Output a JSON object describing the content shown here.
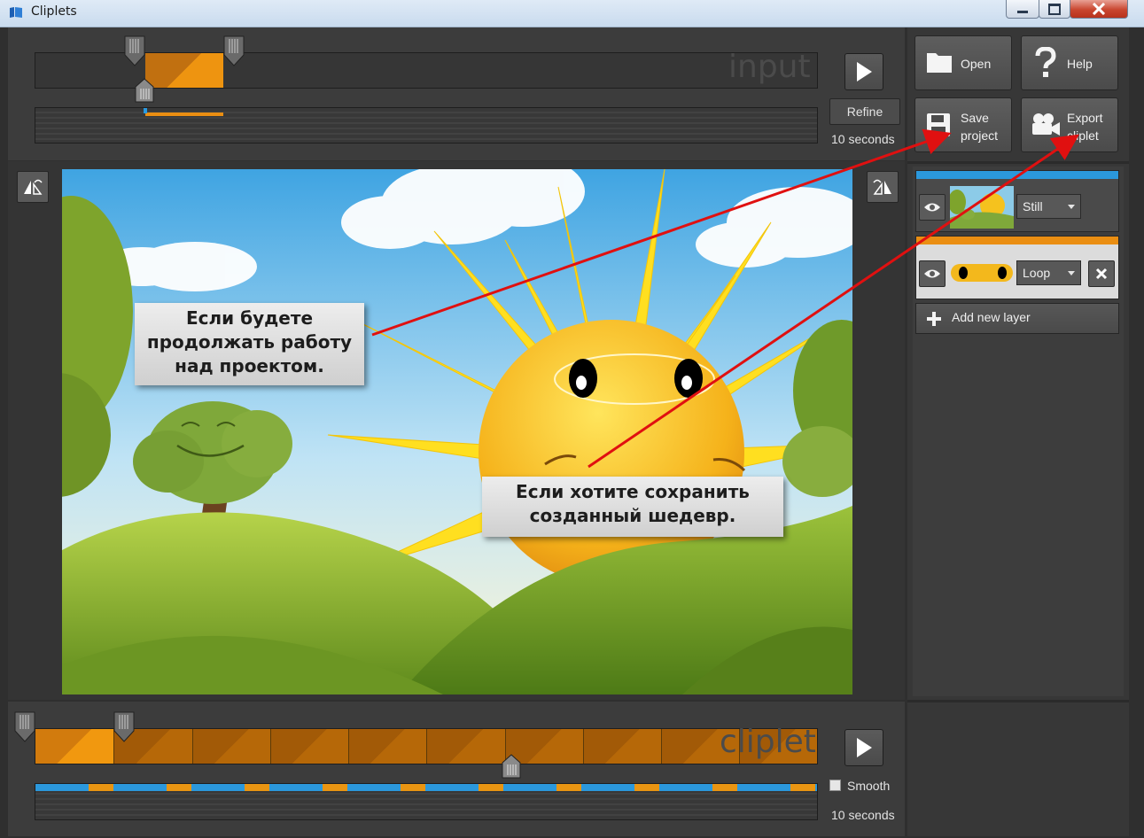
{
  "window": {
    "title": "Cliplets"
  },
  "input_panel": {
    "watermark": "input",
    "refine_label": "Refine",
    "duration": "10 seconds"
  },
  "clip_panel": {
    "watermark": "cliplet",
    "smooth_label": "Smooth",
    "smooth_checked": false,
    "duration": "10 seconds"
  },
  "toolbar": {
    "open_label": "Open",
    "help_label": "Help",
    "save_label_line1": "Save",
    "save_label_line2": "project",
    "export_label_line1": "Export",
    "export_label_line2": "cliplet"
  },
  "layers": [
    {
      "mode": "Still",
      "strip_color": "#2b98dc",
      "selected": false
    },
    {
      "mode": "Loop",
      "strip_color": "#ea8e12",
      "selected": true
    }
  ],
  "add_layer_label": "Add new layer",
  "annotations": {
    "left_line1": "Если будете",
    "left_line2": "продолжать работу",
    "left_line3": "над проектом.",
    "right_line1": "Если хотите сохранить",
    "right_line2": "созданный шедевр.",
    "arrow_color": "#e01010"
  },
  "colors": {
    "accent_orange": "#ee9410",
    "accent_blue": "#2b98dc"
  }
}
